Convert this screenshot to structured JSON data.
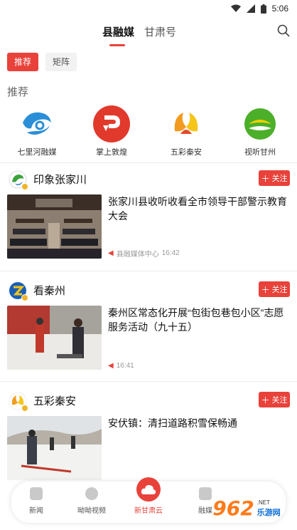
{
  "status_bar": {
    "time": "5:06"
  },
  "top_tabs": [
    {
      "label": "县融媒",
      "active": true
    },
    {
      "label": "甘肃号",
      "active": false
    }
  ],
  "icons": {
    "search": "search-icon",
    "wifi": "wifi-icon",
    "signal": "signal-icon",
    "battery": "battery-icon",
    "follow_plus": "plus-icon",
    "speaker": "speaker-icon"
  },
  "filters": [
    {
      "label": "推荐",
      "active": true
    },
    {
      "label": "矩阵",
      "active": false
    }
  ],
  "recommend": {
    "title": "推荐",
    "accounts": [
      {
        "name": "七里河融媒"
      },
      {
        "name": "掌上敦煌",
        "logo_text": "掌上敦煌"
      },
      {
        "name": "五彩秦安"
      },
      {
        "name": "视听甘州"
      }
    ]
  },
  "feed": [
    {
      "channel": "印象张家川",
      "follow_label": "关注",
      "title": "张家川县收听收看全市领导干部警示教育大会",
      "source": "县融媒体中心",
      "time": "16:42"
    },
    {
      "channel": "看秦州",
      "follow_label": "关注",
      "title": "秦州区常态化开展“包街包巷包小区”志愿服务活动（九十五）",
      "source": "",
      "time": "16:41"
    },
    {
      "channel": "五彩秦安",
      "follow_label": "关注",
      "title": "安伏镇：清扫道路积雪保畅通",
      "source": "",
      "time": ""
    }
  ],
  "bottom_nav": [
    {
      "label": "新闻"
    },
    {
      "label": "呦呦视频"
    },
    {
      "label": "新甘肃云",
      "active": true
    },
    {
      "label": "融媒"
    }
  ],
  "watermark": {
    "number": "962",
    "site": "乐游网",
    "url": ".NET"
  },
  "colors": {
    "accent": "#e8423a",
    "text": "#111111",
    "muted": "#999999"
  }
}
